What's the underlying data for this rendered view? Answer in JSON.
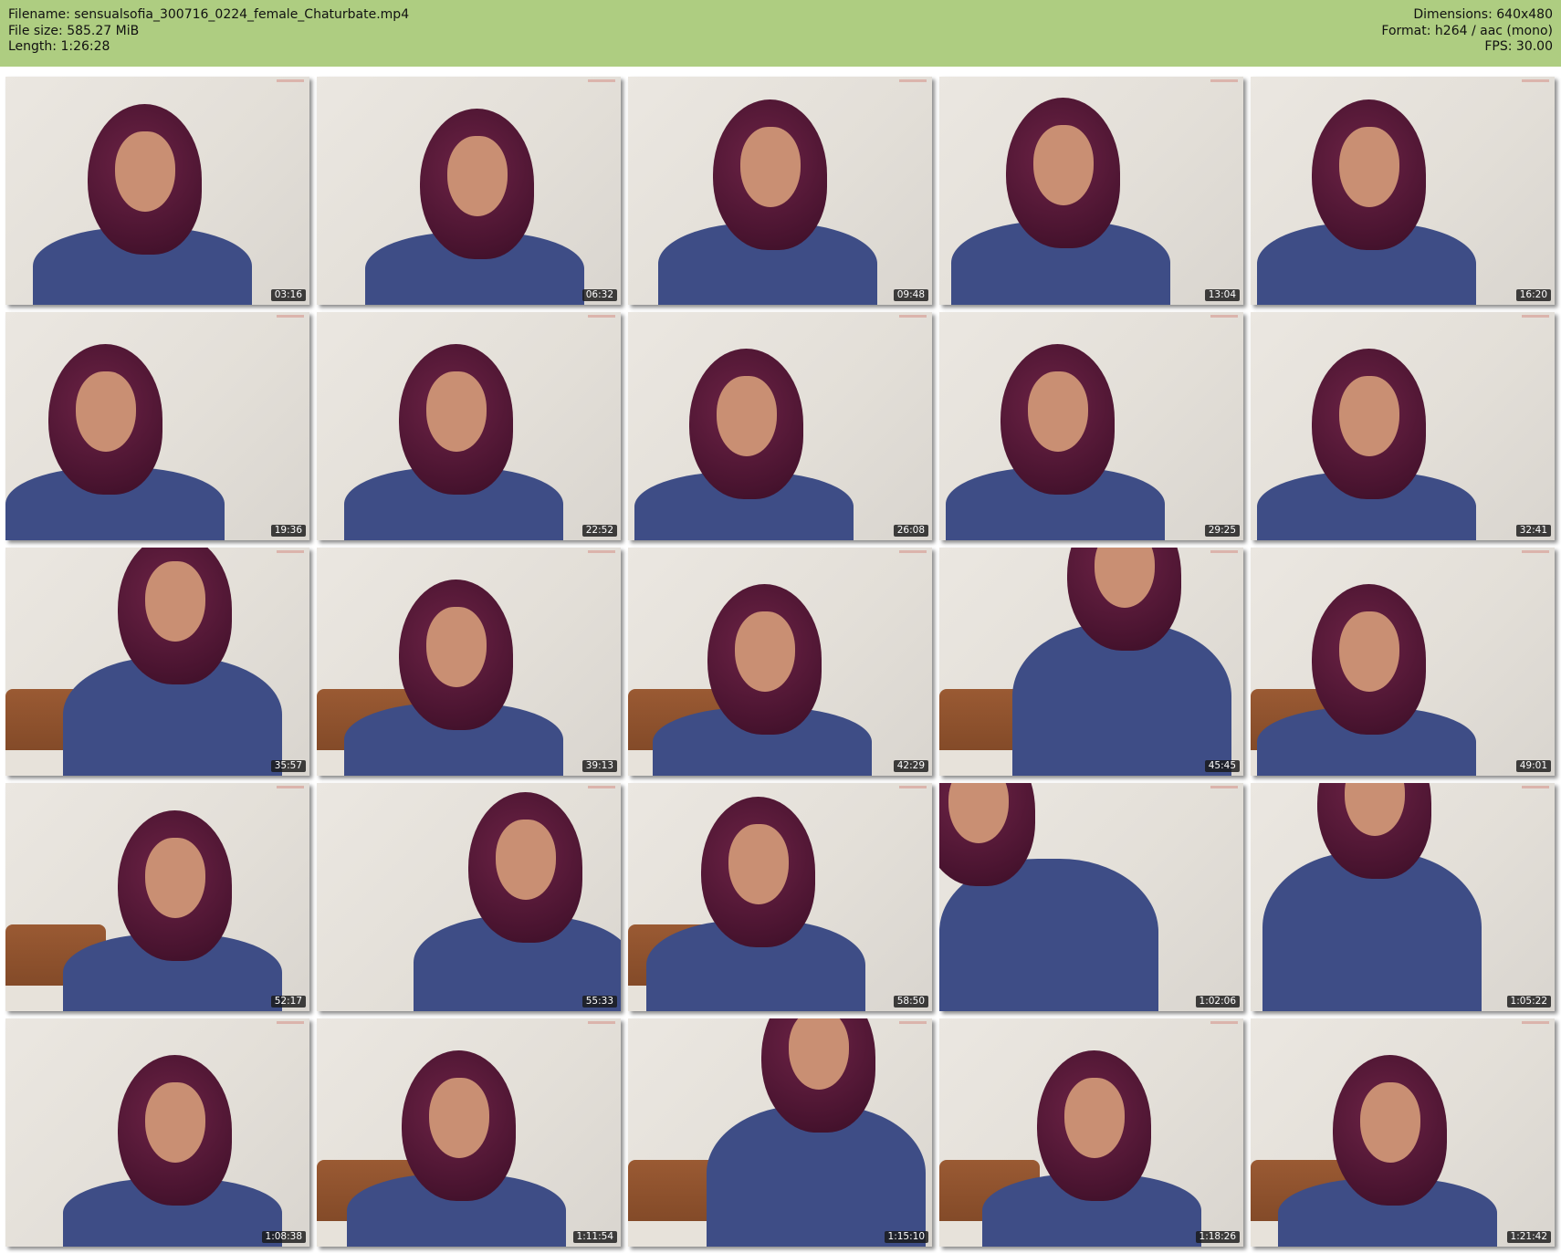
{
  "header": {
    "filename": "Filename: sensualsofia_300716_0224_female_Chaturbate.mp4",
    "filesize": "File size: 585.27 MiB",
    "length": "Length: 1:26:28",
    "dimensions": "Dimensions: 640x480",
    "format": "Format: h264 / aac (mono)",
    "fps": "FPS: 30.00"
  },
  "thumbnails": [
    {
      "time": "03:16"
    },
    {
      "time": "06:32"
    },
    {
      "time": "09:48"
    },
    {
      "time": "13:04"
    },
    {
      "time": "16:20"
    },
    {
      "time": "19:36"
    },
    {
      "time": "22:52"
    },
    {
      "time": "26:08"
    },
    {
      "time": "29:25"
    },
    {
      "time": "32:41"
    },
    {
      "time": "35:57"
    },
    {
      "time": "39:13"
    },
    {
      "time": "42:29"
    },
    {
      "time": "45:45"
    },
    {
      "time": "49:01"
    },
    {
      "time": "52:17"
    },
    {
      "time": "55:33"
    },
    {
      "time": "58:50"
    },
    {
      "time": "1:02:06"
    },
    {
      "time": "1:05:22"
    },
    {
      "time": "1:08:38"
    },
    {
      "time": "1:11:54"
    },
    {
      "time": "1:15:10"
    },
    {
      "time": "1:18:26"
    },
    {
      "time": "1:21:42"
    }
  ]
}
